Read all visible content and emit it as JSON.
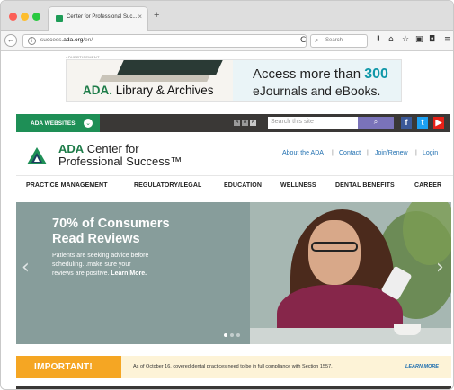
{
  "browser": {
    "tab_title": "Center for Professional Suc...",
    "tab_close": "×",
    "new_tab": "+",
    "back": "←",
    "url_prefix": "success.",
    "url_domain": "ada.org",
    "url_path": "/en/",
    "reload": "C",
    "search_placeholder": "Search",
    "toolbar_icons": [
      "download-icon",
      "home-icon",
      "bookmark-star-icon",
      "clipboard-icon",
      "pocket-icon",
      "menu-icon"
    ]
  },
  "ad": {
    "label": "ADVERTISEMENT",
    "brand": "ADA.",
    "brand_rest": " Library & Archives",
    "line1_pre": "Access more than ",
    "line1_num": "300",
    "line2": "eJournals and eBooks."
  },
  "utility": {
    "websites_label": "ADA WEBSITES",
    "font_sizes": [
      "A",
      "A",
      "A"
    ],
    "search_placeholder": "Search this site",
    "search_button": "🔍",
    "social": [
      "f",
      "t",
      "▶"
    ]
  },
  "header": {
    "logo_line1_bold": "ADA",
    "logo_line1_rest": " Center for",
    "logo_line2": "Professional Success™",
    "links": [
      "About the ADA",
      "Contact",
      "Join/Renew",
      "Login"
    ],
    "separator": "|"
  },
  "nav": {
    "items": [
      "PRACTICE MANAGEMENT",
      "REGULATORY/LEGAL",
      "EDUCATION",
      "WELLNESS",
      "DENTAL BENEFITS",
      "CAREER"
    ]
  },
  "hero": {
    "title_line1": "70% of Consumers",
    "title_line2": "Read Reviews",
    "body_line1": "Patients are seeking advice before",
    "body_line2": "scheduling...make sure your",
    "body_line3_pre": "reviews are positive. ",
    "body_line3_link": "Learn More.",
    "prev": "‹",
    "next": "›",
    "slide_count": 3,
    "active_slide": 1
  },
  "notice": {
    "tag": "IMPORTANT!",
    "text": "As of October 16, covered dental practices need to be in full compliance with Section 1557.",
    "link": "LEARN MORE"
  },
  "colors": {
    "brand_green": "#1e8f56",
    "utility_dark": "#3a3836",
    "link_blue": "#1f6fb0",
    "important_orange": "#f5a623",
    "hero_teal": "#879d9b"
  }
}
